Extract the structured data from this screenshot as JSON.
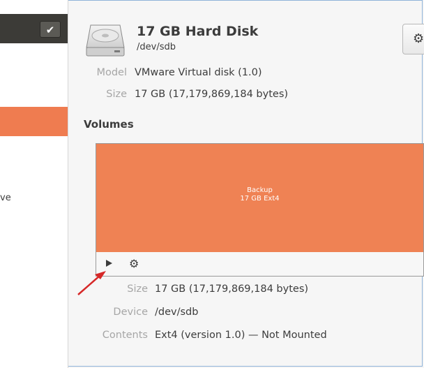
{
  "sidebar": {
    "fragment_text": "ve"
  },
  "disk": {
    "title": "17 GB Hard Disk",
    "device_path": "/dev/sdb",
    "model_label": "Model",
    "model_value": "VMware Virtual disk (1.0)",
    "size_label": "Size",
    "size_value": "17 GB (17,179,869,184 bytes)"
  },
  "volumes": {
    "heading": "Volumes",
    "partition": {
      "name": "Backup",
      "size": "17 GB Ext4",
      "color": "#ef8254"
    }
  },
  "details": {
    "size_label": "Size",
    "size_value": "17 GB (17,179,869,184 bytes)",
    "device_label": "Device",
    "device_value": "/dev/sdb",
    "contents_label": "Contents",
    "contents_value": "Ext4 (version 1.0) — Not Mounted"
  },
  "colors": {
    "accent": "#ef7c50",
    "annotation_arrow": "#d62828"
  },
  "icons": {
    "disk": "hard-disk-icon",
    "settings": "gear-icon",
    "mount": "play-icon",
    "partition_settings": "gears-icon",
    "check": "check-icon"
  }
}
